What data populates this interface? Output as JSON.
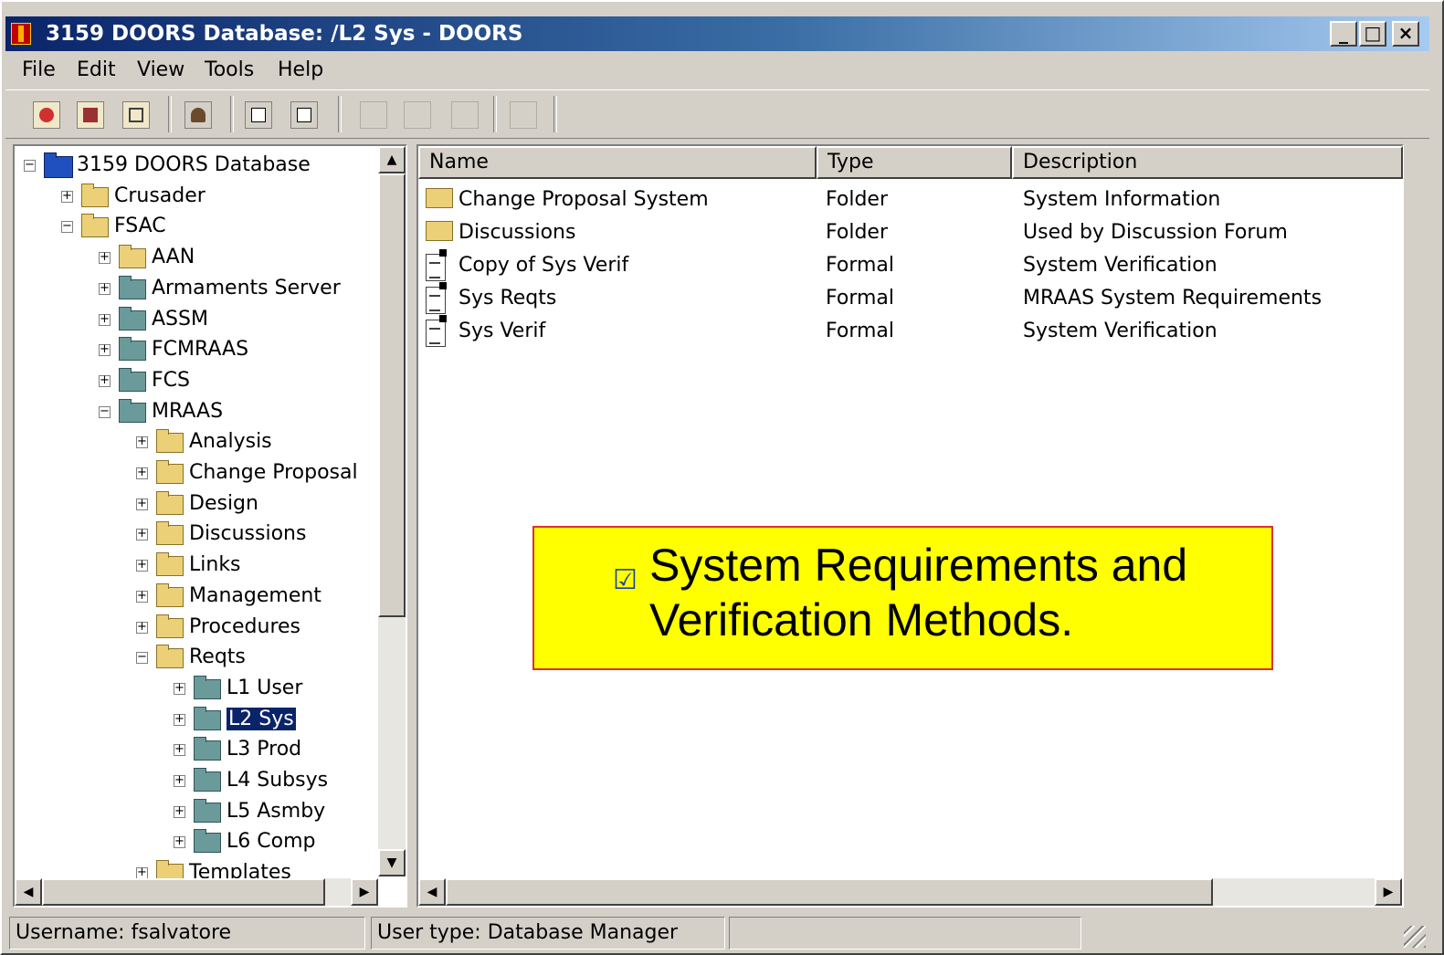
{
  "window": {
    "title": "3159 DOORS Database: /L2 Sys - DOORS",
    "buttons": {
      "minimize": "_",
      "maximize": "□",
      "close": "×"
    }
  },
  "menu": [
    "File",
    "Edit",
    "View",
    "Tools",
    "Help"
  ],
  "toolbar": {
    "icons": [
      "new-folder-icon",
      "new-project-icon",
      "up-level-icon",
      "user-manager-icon",
      "new-formal-module-icon",
      "new-link-module-icon",
      "cut-icon",
      "copy-icon",
      "paste-icon",
      "delete-icon"
    ]
  },
  "tree": {
    "items": [
      {
        "label": "3159 DOORS Database",
        "expander": "−",
        "kind": "database"
      },
      {
        "label": "Crusader",
        "expander": "+",
        "kind": "folder"
      },
      {
        "label": "FSAC",
        "expander": "−",
        "kind": "folder"
      },
      {
        "label": "AAN",
        "expander": "+",
        "kind": "folder"
      },
      {
        "label": "Armaments Server",
        "expander": "+",
        "kind": "project"
      },
      {
        "label": "ASSM",
        "expander": "+",
        "kind": "project"
      },
      {
        "label": "FCMRAAS",
        "expander": "+",
        "kind": "project"
      },
      {
        "label": "FCS",
        "expander": "+",
        "kind": "project"
      },
      {
        "label": "MRAAS",
        "expander": "−",
        "kind": "project"
      },
      {
        "label": "Analysis",
        "expander": "+",
        "kind": "folder"
      },
      {
        "label": "Change Proposal",
        "expander": "+",
        "kind": "folder"
      },
      {
        "label": "Design",
        "expander": "+",
        "kind": "folder"
      },
      {
        "label": "Discussions",
        "expander": "+",
        "kind": "folder"
      },
      {
        "label": "Links",
        "expander": "+",
        "kind": "folder"
      },
      {
        "label": "Management",
        "expander": "+",
        "kind": "folder"
      },
      {
        "label": "Procedures",
        "expander": "+",
        "kind": "folder"
      },
      {
        "label": "Reqts",
        "expander": "−",
        "kind": "folder"
      },
      {
        "label": "L1 User",
        "expander": "+",
        "kind": "project"
      },
      {
        "label": "L2 Sys",
        "expander": "+",
        "kind": "project",
        "selected": true
      },
      {
        "label": "L3 Prod",
        "expander": "+",
        "kind": "project"
      },
      {
        "label": "L4 Subsys",
        "expander": "+",
        "kind": "project"
      },
      {
        "label": "L5 Asmby",
        "expander": "+",
        "kind": "project"
      },
      {
        "label": "L6 Comp",
        "expander": "+",
        "kind": "project"
      },
      {
        "label": "Templates",
        "expander": "+",
        "kind": "folder"
      }
    ]
  },
  "list": {
    "headers": {
      "name": "Name",
      "type": "Type",
      "description": "Description"
    },
    "rows": [
      {
        "name": "Change Proposal System",
        "type": "Folder",
        "description": "System Information",
        "icon": "folder-icon"
      },
      {
        "name": "Discussions",
        "type": "Folder",
        "description": "Used by Discussion Forum",
        "icon": "folder-icon"
      },
      {
        "name": "Copy of Sys Verif",
        "type": "Formal",
        "description": "System Verification",
        "icon": "formal-module-icon"
      },
      {
        "name": "Sys Reqts",
        "type": "Formal",
        "description": "MRAAS System Requirements",
        "icon": "formal-module-icon"
      },
      {
        "name": "Sys Verif",
        "type": "Formal",
        "description": "System Verification",
        "icon": "formal-module-icon"
      }
    ]
  },
  "status": {
    "username": "Username: fsalvatore",
    "usertype": "User type: Database Manager",
    "extra": ""
  },
  "callout": {
    "line1": "System Requirements and",
    "line2": "Verification Methods.",
    "bullet": "☑",
    "colors": {
      "background": "#ffff00",
      "border": "#e0302a"
    }
  },
  "colors": {
    "titlebar_start": "#0a246a",
    "titlebar_end": "#a6caf0",
    "selection": "#0a246a",
    "chrome": "#d4d0c8"
  }
}
